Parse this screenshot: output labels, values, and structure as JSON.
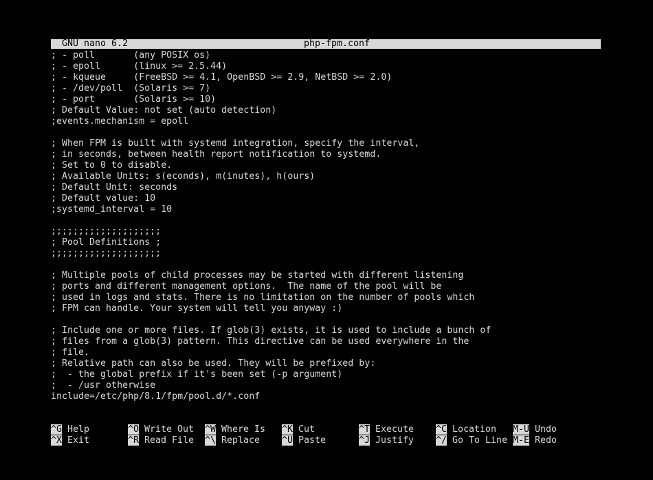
{
  "titlebar": {
    "version": "GNU nano 6.2",
    "filename": "php-fpm.conf"
  },
  "editor": {
    "lines": [
      "; - poll       (any POSIX os)",
      "; - epoll      (linux >= 2.5.44)",
      "; - kqueue     (FreeBSD >= 4.1, OpenBSD >= 2.9, NetBSD >= 2.0)",
      "; - /dev/poll  (Solaris >= 7)",
      "; - port       (Solaris >= 10)",
      "; Default Value: not set (auto detection)",
      ";events.mechanism = epoll",
      "",
      "; When FPM is built with systemd integration, specify the interval,",
      "; in seconds, between health report notification to systemd.",
      "; Set to 0 to disable.",
      "; Available Units: s(econds), m(inutes), h(ours)",
      "; Default Unit: seconds",
      "; Default value: 10",
      ";systemd_interval = 10",
      "",
      ";;;;;;;;;;;;;;;;;;;;",
      "; Pool Definitions ;",
      ";;;;;;;;;;;;;;;;;;;;",
      "",
      "; Multiple pools of child processes may be started with different listening",
      "; ports and different management options.  The name of the pool will be",
      "; used in logs and stats. There is no limitation on the number of pools which",
      "; FPM can handle. Your system will tell you anyway :)",
      "",
      "; Include one or more files. If glob(3) exists, it is used to include a bunch of",
      "; files from a glob(3) pattern. This directive can be used everywhere in the",
      "; file.",
      "; Relative path can also be used. They will be prefixed by:",
      ";  - the global prefix if it's been set (-p argument)",
      ";  - /usr otherwise",
      "include=/etc/php/8.1/fpm/pool.d/*.conf"
    ]
  },
  "shortcuts": {
    "row1": [
      {
        "key": "^G",
        "label": "Help"
      },
      {
        "key": "^O",
        "label": "Write Out"
      },
      {
        "key": "^W",
        "label": "Where Is"
      },
      {
        "key": "^K",
        "label": "Cut"
      },
      {
        "key": "^T",
        "label": "Execute"
      },
      {
        "key": "^C",
        "label": "Location"
      },
      {
        "key": "M-U",
        "label": "Undo"
      }
    ],
    "row2": [
      {
        "key": "^X",
        "label": "Exit"
      },
      {
        "key": "^R",
        "label": "Read File"
      },
      {
        "key": "^\\",
        "label": "Replace"
      },
      {
        "key": "^U",
        "label": "Paste"
      },
      {
        "key": "^J",
        "label": "Justify"
      },
      {
        "key": "^/",
        "label": "Go To Line"
      },
      {
        "key": "M-E",
        "label": "Redo"
      }
    ]
  },
  "colors": {
    "background": "#000000",
    "foreground": "#d8d8d8",
    "highlight": "#d8d8d8"
  }
}
